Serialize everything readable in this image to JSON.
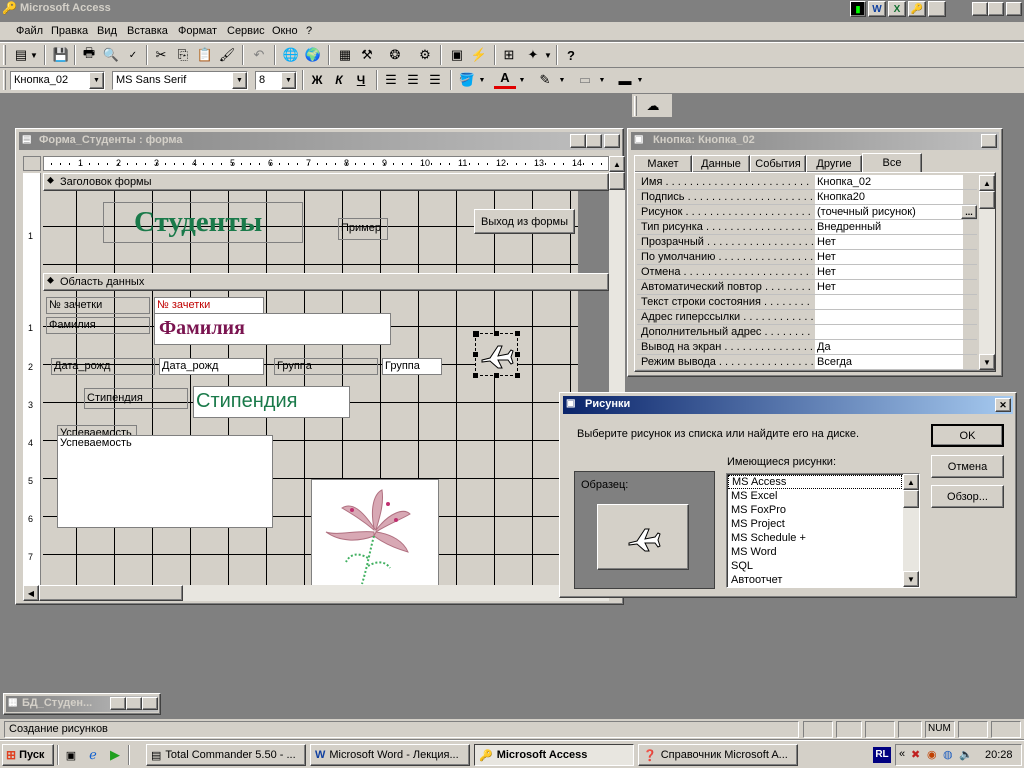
{
  "app": {
    "title": "Microsoft Access"
  },
  "menu": [
    "Файл",
    "Правка",
    "Вид",
    "Вставка",
    "Формат",
    "Сервис",
    "Окно",
    "?"
  ],
  "format_bar": {
    "object": "Кнопка_02",
    "font": "MS Sans Serif",
    "size": "8",
    "bold": "Ж",
    "italic": "К",
    "underline": "Ч"
  },
  "form_window": {
    "title": "Форма_Студенты : форма",
    "ruler": [
      "1",
      "2",
      "3",
      "4",
      "5",
      "6",
      "7",
      "8",
      "9",
      "10",
      "11",
      "12",
      "13",
      "14"
    ],
    "vruler_header": [
      "1"
    ],
    "vruler_body": [
      "1",
      "2",
      "3",
      "4",
      "5",
      "6",
      "7"
    ],
    "header_section": "Заголовок формы",
    "header_title": "Студенты",
    "example_label": "Пример",
    "exit_button": "Выход из формы",
    "data_section": "Область данных",
    "fields": {
      "zach_label": "№ зачетки",
      "zach_value": "№ зачетки",
      "fam_label": "Фамилия",
      "fam_value": "Фамилия",
      "dr_label": "Дата_рожд",
      "dr_value": "Дата_рожд",
      "gr_label": "Группа",
      "gr_value": "Группа",
      "st_label": "Стипендия",
      "st_value": "Стипендия",
      "usp_label": "Успеваемость",
      "usp_value": "Успеваемость"
    }
  },
  "props_window": {
    "title": "Кнопка: Кнопка_02",
    "tabs": [
      "Макет",
      "Данные",
      "События",
      "Другие",
      "Все"
    ],
    "rows": [
      {
        "name": "Имя",
        "value": "Кнопка_02"
      },
      {
        "name": "Подпись",
        "value": "Кнопка20"
      },
      {
        "name": "Рисунок",
        "value": "(точечный рисунок)"
      },
      {
        "name": "Тип рисунка",
        "value": "Внедренный"
      },
      {
        "name": "Прозрачный",
        "value": "Нет"
      },
      {
        "name": "По умолчанию",
        "value": "Нет"
      },
      {
        "name": "Отмена",
        "value": "Нет"
      },
      {
        "name": "Автоматический повтор",
        "value": "Нет"
      },
      {
        "name": "Текст строки состояния",
        "value": ""
      },
      {
        "name": "Адрес гиперссылки",
        "value": ""
      },
      {
        "name": "Дополнительный адрес",
        "value": ""
      },
      {
        "name": "Вывод на экран",
        "value": "Да"
      },
      {
        "name": "Режим вывода",
        "value": "Всегда"
      }
    ],
    "ellipsis": "..."
  },
  "picture_dialog": {
    "title": "Рисунки",
    "prompt": "Выберите рисунок из списка или найдите его на диске.",
    "ok": "OK",
    "cancel": "Отмена",
    "browse": "Обзор...",
    "sample_label": "Образец:",
    "list_label": "Имеющиеся рисунки:",
    "items": [
      "MS Access",
      "MS Excel",
      "MS FoxPro",
      "MS Project",
      "MS Schedule +",
      "MS Word",
      "SQL",
      "Автоотчет"
    ]
  },
  "db_window": {
    "title": "БД_Студен..."
  },
  "statusbar": {
    "text": "Создание рисунков",
    "num": "NUM"
  },
  "taskbar": {
    "start": "Пуск",
    "tasks": [
      "Total Commander 5.50 - ...",
      "Microsoft Word - Лекция...",
      "Microsoft Access",
      "Справочник Microsoft A..."
    ],
    "lang": "RL",
    "time": "20:28"
  },
  "colors": {
    "title_active": "#0a246a",
    "header_text": "#1a7a4a",
    "fam_text": "#7a1450",
    "st_text": "#1a7a4a"
  }
}
